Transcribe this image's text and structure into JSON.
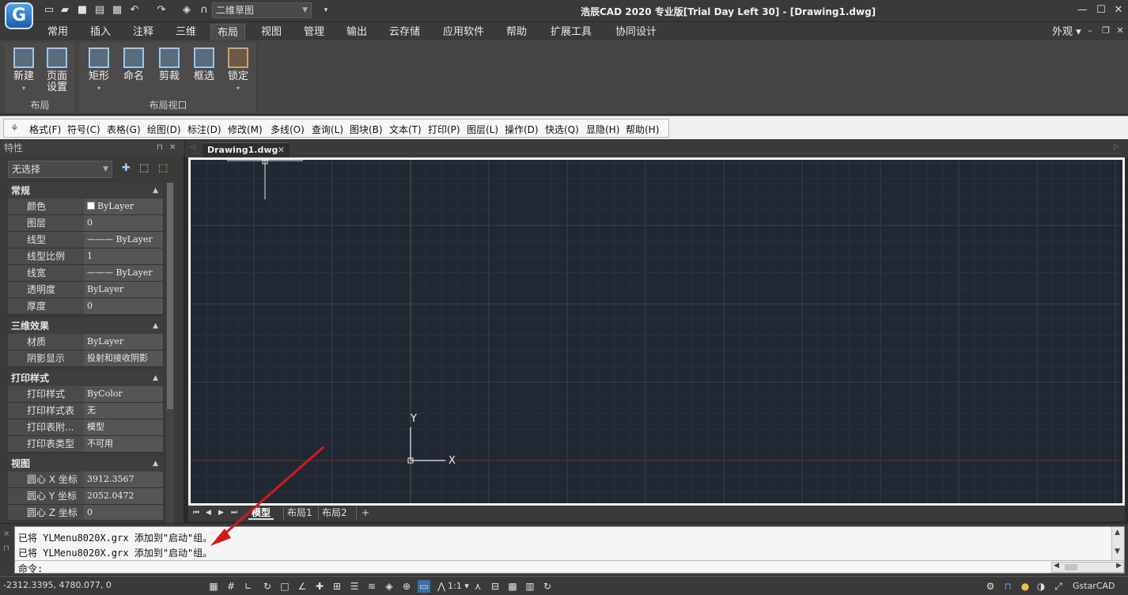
{
  "title_bar": {
    "workspace": "二维草图",
    "app_title": "浩辰CAD 2020 专业版[Trial Day Left 30] - [Drawing1.dwg]"
  },
  "ribbon_tabs": [
    "常用",
    "插入",
    "注释",
    "三维",
    "布局",
    "视图",
    "管理",
    "输出",
    "云存储",
    "应用软件",
    "帮助",
    "扩展工具",
    "协同设计"
  ],
  "ribbon_active": "布局",
  "ribbon_right": "外观",
  "ribbon_groups": [
    {
      "title": "布局",
      "buttons": [
        {
          "label": "新建"
        },
        {
          "label": "页面\n设置"
        }
      ]
    },
    {
      "title": "布局视口",
      "buttons": [
        {
          "label": "矩形"
        },
        {
          "label": "命名"
        },
        {
          "label": "剪裁"
        },
        {
          "label": "框选"
        },
        {
          "label": "锁定"
        }
      ]
    }
  ],
  "classic_menu": [
    "格式(F)",
    "符号(C)",
    "表格(G)",
    "绘图(D)",
    "标注(D)",
    "修改(M)",
    "多线(O)",
    "查询(L)",
    "图块(B)",
    "文本(T)",
    "打印(P)",
    "图层(L)",
    "操作(D)",
    "快选(Q)",
    "显隐(H)",
    "帮助(H)"
  ],
  "properties": {
    "panel_title": "特性",
    "selection": "无选择",
    "sections": [
      {
        "title": "常规",
        "rows": [
          {
            "key": "颜色",
            "value": "ByLayer"
          },
          {
            "key": "图层",
            "value": "0"
          },
          {
            "key": "线型",
            "value": "——— ByLayer"
          },
          {
            "key": "线型比例",
            "value": "1"
          },
          {
            "key": "线宽",
            "value": "——— ByLayer"
          },
          {
            "key": "透明度",
            "value": "ByLayer"
          },
          {
            "key": "厚度",
            "value": "0"
          }
        ]
      },
      {
        "title": "三维效果",
        "rows": [
          {
            "key": "材质",
            "value": "ByLayer"
          },
          {
            "key": "阴影显示",
            "value": "投射和接收阴影"
          }
        ]
      },
      {
        "title": "打印样式",
        "rows": [
          {
            "key": "打印样式",
            "value": "ByColor"
          },
          {
            "key": "打印样式表",
            "value": "无"
          },
          {
            "key": "打印表附...",
            "value": "模型"
          },
          {
            "key": "打印表类型",
            "value": "不可用"
          }
        ]
      },
      {
        "title": "视图",
        "rows": [
          {
            "key": "圆心 X 坐标",
            "value": "3912.3567"
          },
          {
            "key": "圆心 Y 坐标",
            "value": "2052.0472"
          },
          {
            "key": "圆心 Z 坐标",
            "value": "0"
          }
        ]
      }
    ]
  },
  "document_tab": "Drawing1.dwg",
  "ucs": {
    "x_label": "X",
    "y_label": "Y"
  },
  "layout_tabs": [
    "模型",
    "布局1",
    "布局2",
    "+"
  ],
  "command": {
    "lines": [
      "已将 YLMenu8020X.grx 添加到\"启动\"组。",
      "已将 YLMenu8020X.grx 添加到\"启动\"组。"
    ],
    "prompt": "命令:"
  },
  "status": {
    "coords": "-2312.3395, 4780.077, 0",
    "scale": "1:1",
    "brand": "GstarCAD"
  },
  "colors": {
    "canvas": "#212833",
    "grid": "#2f3a46",
    "x_axis": "#8a2a2a",
    "y_axis": "#2f6a3a",
    "arrow": "#d11a1a"
  }
}
